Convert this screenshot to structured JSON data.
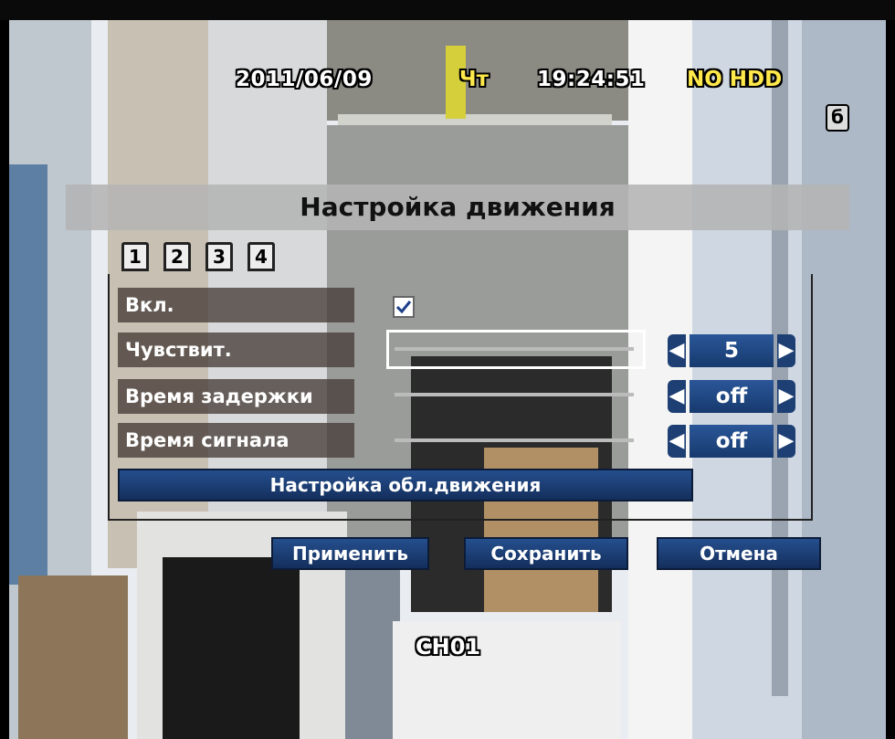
{
  "osd": {
    "date": "2011/06/09",
    "day": "Чт",
    "time": "19:24:51",
    "hdd_status": "NO HDD",
    "rec_icon": "б",
    "channel": "CH01"
  },
  "dialog": {
    "title": "Настройка движения",
    "tabs": [
      "1",
      "2",
      "3",
      "4"
    ],
    "rows": {
      "enable_label": "Вкл.",
      "enable_checked": true,
      "sensitivity_label": "Чувствит.",
      "sensitivity_value": "5",
      "delay_label": "Время задержки",
      "delay_value": "off",
      "signal_label": "Время сигнала",
      "signal_value": "off"
    },
    "motion_area_button": "Настройка обл.движения",
    "buttons": {
      "apply": "Применить",
      "save": "Сохранить",
      "cancel": "Отмена"
    }
  },
  "icons": {
    "check": "checkmark-icon",
    "left": "arrow-left-icon",
    "right": "arrow-right-icon"
  },
  "colors": {
    "button_blue": "#1e3f73",
    "osd_yellow": "#ffe94a",
    "panel_gray": "#b4b4b4"
  }
}
